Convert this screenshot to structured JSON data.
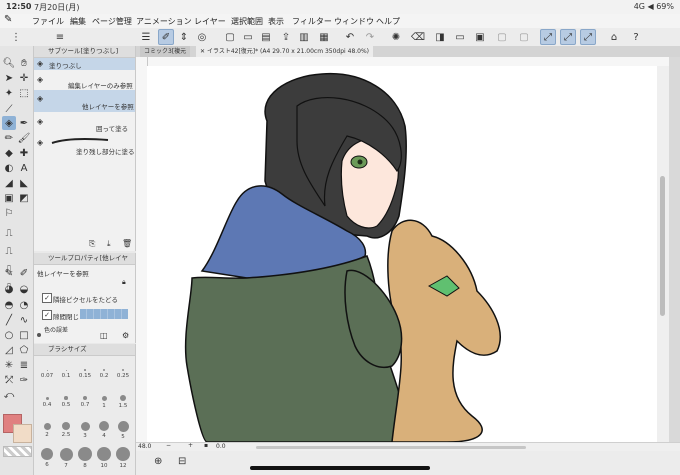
{
  "status": {
    "time": "12:50",
    "date": "7月20日(月)",
    "right": "4G ◀ 69%"
  },
  "menu": [
    "ファイル",
    "編集",
    "ページ管理",
    "アニメーション",
    "レイヤー",
    "選択範囲",
    "表示",
    "フィルター",
    "ウィンドウ",
    "ヘルプ"
  ],
  "subtool": {
    "header": "サブツール[塗りつぶし]",
    "items": [
      {
        "label": "塗りつぶし"
      },
      {
        "label": "編集レイヤーのみ参照"
      },
      {
        "label": "他レイヤーを参照"
      },
      {
        "label": "囲って塗る"
      },
      {
        "label": "塗り残し部分に塗る"
      }
    ]
  },
  "toolprop": {
    "header": "ツールプロパティ[他レイヤ",
    "title": "他レイヤーを参照",
    "opt1": "隣接ピクセルをたどる",
    "opt2": "隙間閉じ",
    "opt3": "色の誤差"
  },
  "brushsize": {
    "header": "ブラシサイズ",
    "rows": [
      [
        "0.07",
        "0.1",
        "0.15",
        "0.2",
        "0.25"
      ],
      [
        "0.4",
        "0.5",
        "0.7",
        "1",
        "1.5"
      ],
      [
        "2",
        "2.5",
        "3",
        "4",
        "5"
      ],
      [
        "6",
        "7",
        "8",
        "10",
        "12"
      ]
    ]
  },
  "tabs": {
    "tab1": "コミック3[複元",
    "tab2": "イラスト42[復元]* (A4 29.70 x 21.00cm 350dpi 48.0%)"
  },
  "nav": {
    "zoom": "48.0",
    "angle": "0.0"
  },
  "colors": {
    "accent": "#8fb2d6",
    "main_color": "#e08080"
  }
}
